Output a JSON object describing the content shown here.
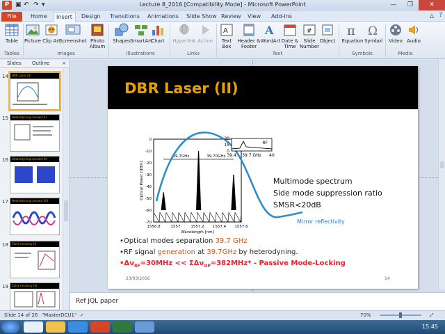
{
  "window": {
    "title": "Lecture 8_2016 [Compatibility Mode] - Microsoft PowerPoint"
  },
  "tabs": [
    "File",
    "Home",
    "Insert",
    "Design",
    "Transitions",
    "Animations",
    "Slide Show",
    "Review",
    "View",
    "Add-Ins"
  ],
  "ribbon": {
    "buttons": [
      "Table",
      "Picture",
      "Clip Art",
      "Screenshot",
      "Photo Album",
      "Shapes",
      "SmartArt",
      "Chart",
      "Hyperlink",
      "Action",
      "Text Box",
      "Header & Footer",
      "WordArt",
      "Date & Time",
      "Slide Number",
      "Object",
      "Equation",
      "Symbol",
      "Video",
      "Audio"
    ],
    "groups": [
      "Tables",
      "Images",
      "Illustrations",
      "Links",
      "Text",
      "Symbols",
      "Media"
    ]
  },
  "pane": {
    "tabs": [
      "Slides",
      "Outline"
    ],
    "close": "×",
    "slides": [
      {
        "num": "14",
        "title": "DBR Laser (II)"
      },
      {
        "num": "15",
        "title": "Heterodyning concept (I)"
      },
      {
        "num": "16",
        "title": "Heterodyning concept (II)"
      },
      {
        "num": "17",
        "title": "Heterodyning concept (III)"
      },
      {
        "num": "18",
        "title": "Clock recovery (I)"
      },
      {
        "num": "19",
        "title": "Clock recovery (II)"
      }
    ]
  },
  "slide": {
    "title": "DBR Laser (II)",
    "right_lines": [
      "Multimode spectrum",
      "Side mode suppression ratio",
      "SMSR<20dB"
    ],
    "mirror_label": "Mirror reflectivity",
    "inset": {
      "label": "RF",
      "yticks": [
        "30",
        "15",
        "0"
      ],
      "xticks": [
        "39.4",
        "39.7 GHz",
        "40"
      ]
    },
    "bullets": [
      {
        "pre": "•Optical modes separation ",
        "hl": "39.7 GHz",
        "post": ""
      },
      {
        "pre": "•RF signal ",
        "hl": "generation",
        "mid": " at ",
        "hl2": "39.7GHz",
        "post": " by heterodyning."
      },
      {
        "main": "•Δν",
        "sub1": "RF",
        "m2": "=30MHz << ΣΔν",
        "sub2": "OP",
        "m3": "=382MHz* - Passive Mode-Locking"
      }
    ],
    "date": "23/03/2016",
    "page": "14"
  },
  "chart_data": {
    "type": "line",
    "title": "",
    "xlabel": "Wavelength [nm]",
    "ylabel": "Optical Power [dBm]",
    "xlim": [
      1556.8,
      1557.6
    ],
    "ylim": [
      -70,
      0
    ],
    "x_ticks": [
      "1556.8",
      "1557",
      "1557.2",
      "1557.4",
      "1557.6"
    ],
    "y_ticks": [
      "0",
      "-10",
      "-20",
      "-30",
      "-40",
      "-50",
      "-60",
      "-70"
    ],
    "peaks": [
      {
        "x": 1556.89,
        "y": -45
      },
      {
        "x": 1557.21,
        "y": -10
      },
      {
        "x": 1557.53,
        "y": -30
      }
    ],
    "annotations": [
      "39.7GHz",
      "39.70GHz"
    ]
  },
  "notes": {
    "text": "Ref JQL paper"
  },
  "status": {
    "slide": "Slide 14 of 26",
    "theme": "\"MasterDCU1\"",
    "zoom": "70%"
  },
  "taskbar": {
    "time": "15:45"
  }
}
